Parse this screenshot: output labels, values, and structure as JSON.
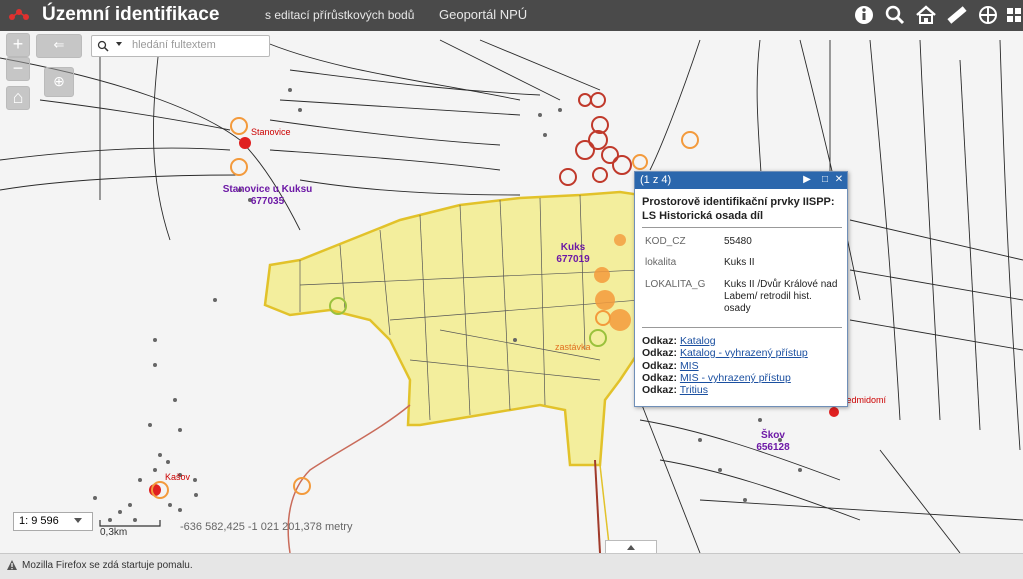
{
  "header": {
    "app_title": "Územní identifikace",
    "subtitle": "s editací přírůstkových bodů",
    "geoportal_link": "Geoportál NPÚ",
    "toolbar_icons": [
      "info-icon",
      "search-icon",
      "home-icon",
      "measure-icon",
      "layers-icon",
      "grid-icon"
    ]
  },
  "search": {
    "placeholder": "hledání fultextem"
  },
  "map": {
    "labels": {
      "stanovice": "Stanovice",
      "stanovice_kuksu_name": "Stanovice u Kuksu",
      "stanovice_kuksu_code": "677035",
      "kuks_name": "Kuks",
      "kuks_code": "677019",
      "zastavka": "zastávka",
      "kasov": "Kašov",
      "skov_name": "Škov",
      "skov_code": "656128",
      "nedmidomi": "Nedmidomí"
    },
    "scale": "1: 9 596",
    "scalebar": "0,3km",
    "coordinates": "-636 582,425   -1 021 201,378 metry",
    "colors": {
      "highlight_fill": "#f3ee9d",
      "highlight_stroke": "#e2c22a",
      "point_red": "#e02020",
      "point_orange": "#f39a3c",
      "boundary": "#c0392b"
    }
  },
  "popup": {
    "count": "(1 z 4)",
    "title": "Prostorově identifikační prvky IISPP: LS Historická osada díl",
    "attributes": [
      {
        "key": "KOD_CZ",
        "value": "55480"
      },
      {
        "key": "lokalita",
        "value": "Kuks II"
      },
      {
        "key": "LOKALITA_G",
        "value": "Kuks II /Dvůr Králové nad Labem/ retrodil hist. osady"
      }
    ],
    "links": [
      {
        "label": "Odkaz:",
        "text": "Katalog"
      },
      {
        "label": "Odkaz:",
        "text": "Katalog - vyhrazený přístup"
      },
      {
        "label": "Odkaz:",
        "text": "MIS"
      },
      {
        "label": "Odkaz:",
        "text": "MIS - vyhrazený přístup"
      },
      {
        "label": "Odkaz:",
        "text": "Tritius"
      }
    ]
  },
  "statusbar": {
    "text": "Mozilla Firefox se zdá startuje pomalu."
  }
}
